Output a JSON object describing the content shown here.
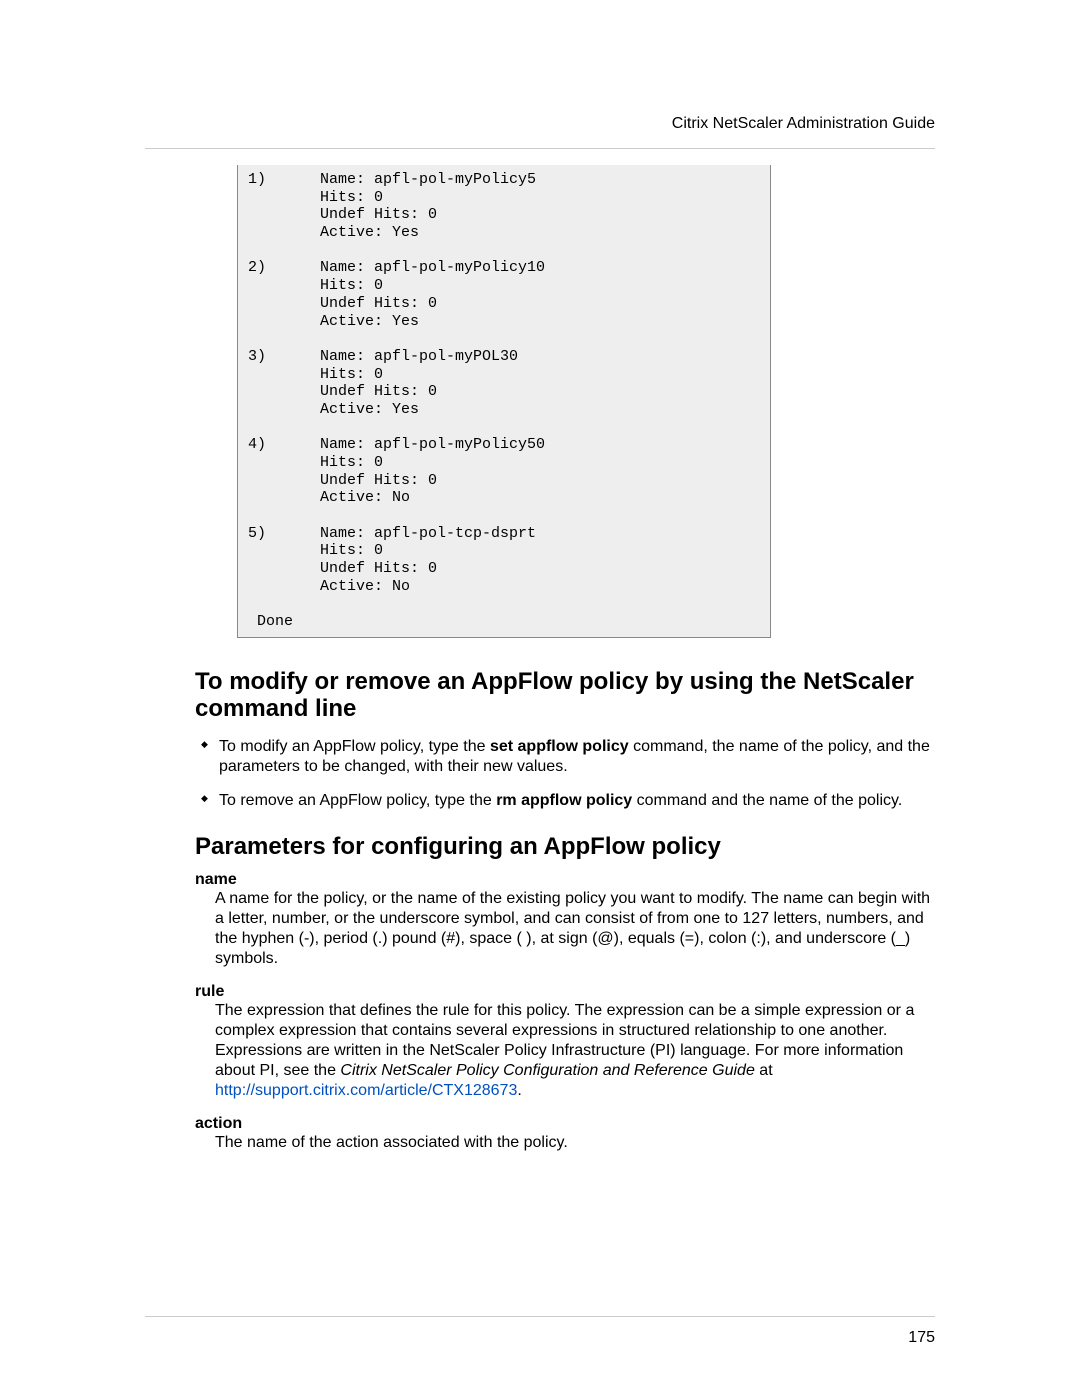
{
  "header": {
    "doc_title": "Citrix NetScaler Administration Guide"
  },
  "code": {
    "text": "1)      Name: apfl-pol-myPolicy5\n        Hits: 0\n        Undef Hits: 0\n        Active: Yes\n\n2)      Name: apfl-pol-myPolicy10\n        Hits: 0\n        Undef Hits: 0\n        Active: Yes\n\n3)      Name: apfl-pol-myPOL30\n        Hits: 0\n        Undef Hits: 0\n        Active: Yes\n\n4)      Name: apfl-pol-myPolicy50\n        Hits: 0\n        Undef Hits: 0\n        Active: No\n\n5)      Name: apfl-pol-tcp-dsprt\n        Hits: 0\n        Undef Hits: 0\n        Active: No\n\n Done"
  },
  "sections": {
    "modify": {
      "heading": "To modify or remove an AppFlow policy by using the NetScaler command line",
      "bullets": [
        {
          "pre": "To modify an AppFlow policy, type the ",
          "cmd": "set appflow policy",
          "post": " command, the name of the policy, and the parameters to be changed, with their new values."
        },
        {
          "pre": "To remove an AppFlow policy, type the ",
          "cmd": "rm appflow policy",
          "post": " command and the name of the policy."
        }
      ]
    },
    "params": {
      "heading": "Parameters for configuring an AppFlow policy",
      "items": {
        "name": {
          "term": "name",
          "desc": "A name for the policy, or the name of the existing policy you want to modify. The name can begin with a letter, number, or the underscore symbol, and can consist of from one to 127 letters, numbers, and the hyphen (-), period (.) pound (#), space ( ), at sign (@), equals (=), colon (:), and underscore (_) symbols."
        },
        "rule": {
          "term": "rule",
          "desc_pre": "The expression that defines the rule for this policy. The expression can be a simple expression or a complex expression that contains several expressions in structured relationship to one another. Expressions are written in the NetScaler Policy Infrastructure (PI) language. For more information about PI, see the ",
          "desc_ital": "Citrix NetScaler Policy Configuration and Reference Guide",
          "desc_at": " at ",
          "link": "http://support.citrix.com/article/CTX128673",
          "period": "."
        },
        "action": {
          "term": "action",
          "desc": "The name of the action associated with the policy."
        }
      }
    }
  },
  "footer": {
    "page_number": "175"
  }
}
